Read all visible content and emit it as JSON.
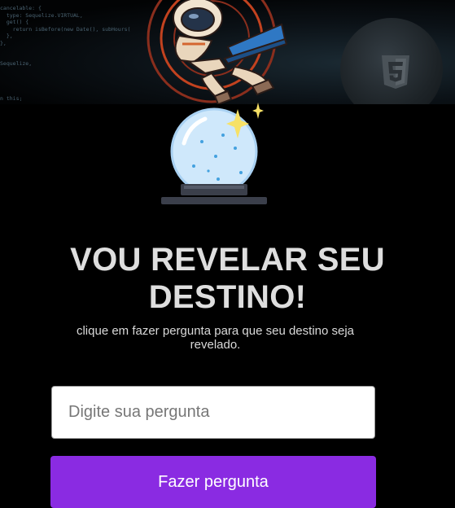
{
  "hero": {
    "code_lines": [
      "cancelable: {",
      "  type: Sequelize.VIRTUAL,",
      "  get() {",
      "    return isBefore(new Date(), subHours(",
      "  },",
      "},",
      "",
      "",
      "Sequelize,",
      "",
      "",
      "",
      "",
      "n this;"
    ],
    "astronaut_image": "astronaut-with-laptop",
    "badge_icon": "html5-icon"
  },
  "crystal_ball_icon": "crystal-ball-icon",
  "headline": "VOU REVELAR SEU DESTINO!",
  "subtitle": "clique em fazer pergunta para que seu destino seja revelado.",
  "input": {
    "placeholder": "Digite sua pergunta",
    "value": ""
  },
  "button": {
    "label": "Fazer pergunta"
  },
  "colors": {
    "background": "#000000",
    "button": "#8a2be2",
    "headline": "#dedede"
  }
}
